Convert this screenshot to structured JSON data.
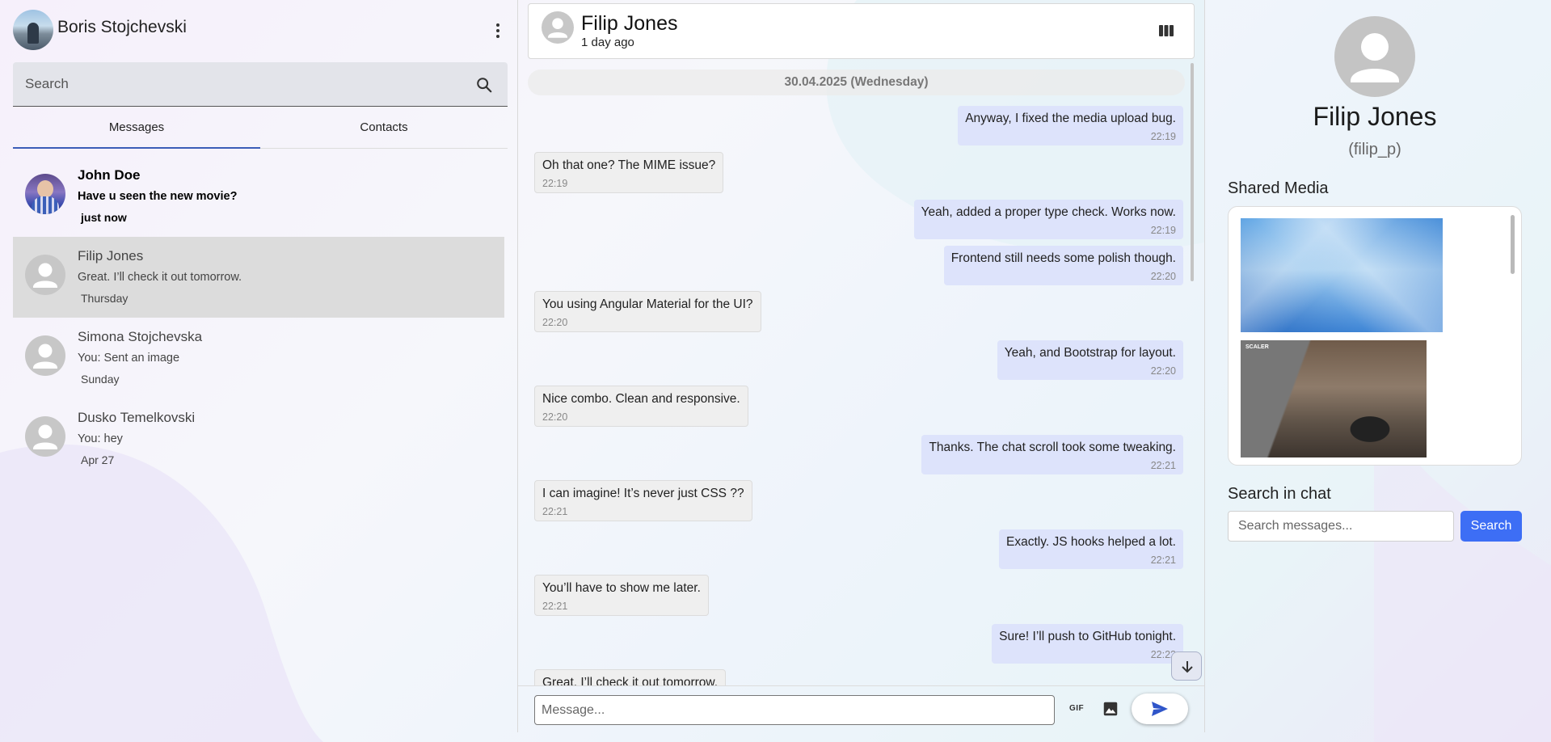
{
  "user": {
    "name": "Boris Stojchevski"
  },
  "sidebar": {
    "search_placeholder": "Search",
    "tabs": [
      {
        "label": "Messages",
        "active": true
      },
      {
        "label": "Contacts",
        "active": false
      }
    ],
    "chats": [
      {
        "name": "John Doe",
        "preview": "Have u seen the new movie?",
        "time": "just now",
        "unread": true
      },
      {
        "name": "Filip Jones",
        "preview": "Great. I’ll check it out tomorrow.",
        "time": "Thursday",
        "selected": true
      },
      {
        "name": "Simona Stojchevska",
        "preview": "You: Sent an image",
        "time": "Sunday"
      },
      {
        "name": "Dusko Temelkovski",
        "preview": "You: hey",
        "time": "Apr 27"
      }
    ]
  },
  "chat": {
    "name": "Filip Jones",
    "status": "1 day ago",
    "date_separator": "30.04.2025 (Wednesday)",
    "messages": [
      {
        "dir": "out",
        "text": "Anyway, I fixed the media upload bug.",
        "time": "22:19"
      },
      {
        "dir": "in",
        "text": "Oh that one? The MIME issue?",
        "time": "22:19"
      },
      {
        "dir": "out",
        "text": "Yeah, added a proper type check. Works now.",
        "time": "22:19"
      },
      {
        "dir": "out",
        "text": "Frontend still needs some polish though.",
        "time": "22:20"
      },
      {
        "dir": "in",
        "text": "You using Angular Material for the UI?",
        "time": "22:20"
      },
      {
        "dir": "out",
        "text": "Yeah, and Bootstrap for layout.",
        "time": "22:20"
      },
      {
        "dir": "in",
        "text": "Nice combo. Clean and responsive.",
        "time": "22:20"
      },
      {
        "dir": "out",
        "text": "Thanks. The chat scroll took some tweaking.",
        "time": "22:21"
      },
      {
        "dir": "in",
        "text": "I can imagine! It’s never just CSS ??",
        "time": "22:21"
      },
      {
        "dir": "out",
        "text": "Exactly. JS hooks helped a lot.",
        "time": "22:21"
      },
      {
        "dir": "in",
        "text": "You’ll have to show me later.",
        "time": "22:21"
      },
      {
        "dir": "out",
        "text": "Sure! I’ll push to GitHub tonight.",
        "time": "22:22"
      },
      {
        "dir": "in",
        "text": "Great. I’ll check it out tomorrow.",
        "time": ""
      }
    ],
    "composer": {
      "placeholder": "Message...",
      "gif_label": "GIF"
    }
  },
  "details": {
    "name": "Filip Jones",
    "username": "(filip_p)",
    "shared_media_title": "Shared Media",
    "media_tag": "SCALER",
    "search_title": "Search in chat",
    "search_placeholder": "Search messages...",
    "search_button": "Search"
  },
  "colors": {
    "accent": "#3d6ef5",
    "tab_underline": "#3b5db8",
    "outgoing_bubble": "#dde3fb",
    "incoming_bubble": "#efefef",
    "selected_chat": "#dcdcdc"
  },
  "icons": [
    "kebab-menu-icon",
    "search-icon",
    "columns-icon",
    "arrow-down-icon",
    "gif-icon",
    "image-icon",
    "send-icon",
    "default-avatar-icon"
  ]
}
